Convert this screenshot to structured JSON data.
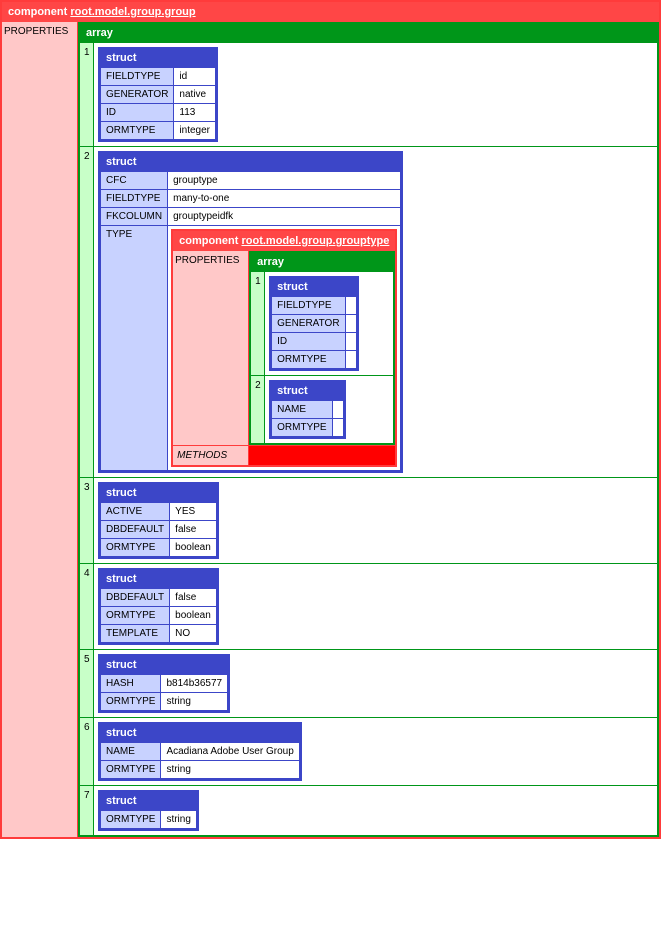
{
  "component": {
    "label": "component",
    "link_text": "root.model.group.group",
    "properties_label": "PROPERTIES",
    "array_label": "array",
    "struct_label": "struct",
    "methods_label": "METHODS",
    "items": [
      {
        "idx": "1",
        "rows": [
          {
            "k": "FIELDTYPE",
            "v": "id"
          },
          {
            "k": "GENERATOR",
            "v": "native"
          },
          {
            "k": "ID",
            "v": "113"
          },
          {
            "k": "ORMTYPE",
            "v": "integer"
          }
        ]
      },
      {
        "idx": "2",
        "rows": [
          {
            "k": "CFC",
            "v": "grouptype"
          },
          {
            "k": "FIELDTYPE",
            "v": "many-to-one"
          },
          {
            "k": "FKCOLUMN",
            "v": "grouptypeidfk"
          },
          {
            "k": "TYPE",
            "nested": true
          }
        ],
        "nested": {
          "label": "component",
          "link_text": "root.model.group.grouptype",
          "properties_label": "PROPERTIES",
          "items": [
            {
              "idx": "1",
              "rows": [
                {
                  "k": "FIELDTYPE",
                  "v": ""
                },
                {
                  "k": "GENERATOR",
                  "v": ""
                },
                {
                  "k": "ID",
                  "v": ""
                },
                {
                  "k": "ORMTYPE",
                  "v": ""
                }
              ]
            },
            {
              "idx": "2",
              "rows": [
                {
                  "k": "NAME",
                  "v": ""
                },
                {
                  "k": "ORMTYPE",
                  "v": ""
                }
              ]
            }
          ]
        }
      },
      {
        "idx": "3",
        "rows": [
          {
            "k": "ACTIVE",
            "v": "YES"
          },
          {
            "k": "DBDEFAULT",
            "v": "false"
          },
          {
            "k": "ORMTYPE",
            "v": "boolean"
          }
        ]
      },
      {
        "idx": "4",
        "rows": [
          {
            "k": "DBDEFAULT",
            "v": "false"
          },
          {
            "k": "ORMTYPE",
            "v": "boolean"
          },
          {
            "k": "TEMPLATE",
            "v": "NO"
          }
        ]
      },
      {
        "idx": "5",
        "rows": [
          {
            "k": "HASH",
            "v": "b814b36577"
          },
          {
            "k": "ORMTYPE",
            "v": "string"
          }
        ]
      },
      {
        "idx": "6",
        "rows": [
          {
            "k": "NAME",
            "v": "Acadiana Adobe User Group"
          },
          {
            "k": "ORMTYPE",
            "v": "string"
          }
        ]
      },
      {
        "idx": "7",
        "rows": [
          {
            "k": "ORMTYPE",
            "v": "string"
          }
        ]
      }
    ]
  }
}
